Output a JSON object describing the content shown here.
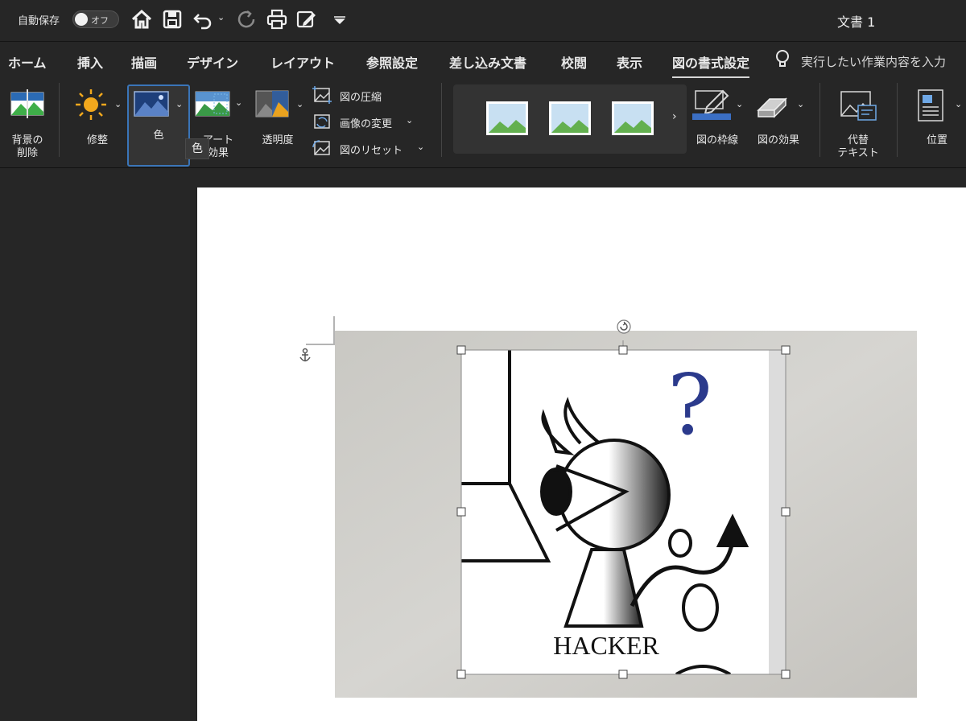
{
  "titlebar": {
    "autosave_label": "自動保存",
    "autosave_toggle": "オフ",
    "doc_title": "文書 1",
    "icons": [
      "home-icon",
      "save-icon",
      "undo-icon",
      "redo-icon",
      "print-icon",
      "edit-icon",
      "customize-icon"
    ]
  },
  "tabs": [
    "ホーム",
    "挿入",
    "描画",
    "デザイン",
    "レイアウト",
    "参照設定",
    "差し込み文書",
    "校閲",
    "表示",
    "図の書式設定"
  ],
  "active_tab": "図の書式設定",
  "tell_me": "実行したい作業内容を入力",
  "ribbon": {
    "remove_bg": "背景の\n削除",
    "corrections": "修整",
    "color": "色",
    "artistic": "アート\n効果",
    "transparency": "透明度",
    "compress": "図の圧縮",
    "change_picture": "画像の変更",
    "reset_picture": "図のリセット",
    "border": "図の枠線",
    "effects": "図の効果",
    "alt_text": "代替\nテキスト",
    "position": "位置"
  },
  "tooltip": "色",
  "image_text": "HACKER",
  "colors": {
    "accent": "#3a75b8",
    "border_blue": "#3b6fc4"
  }
}
